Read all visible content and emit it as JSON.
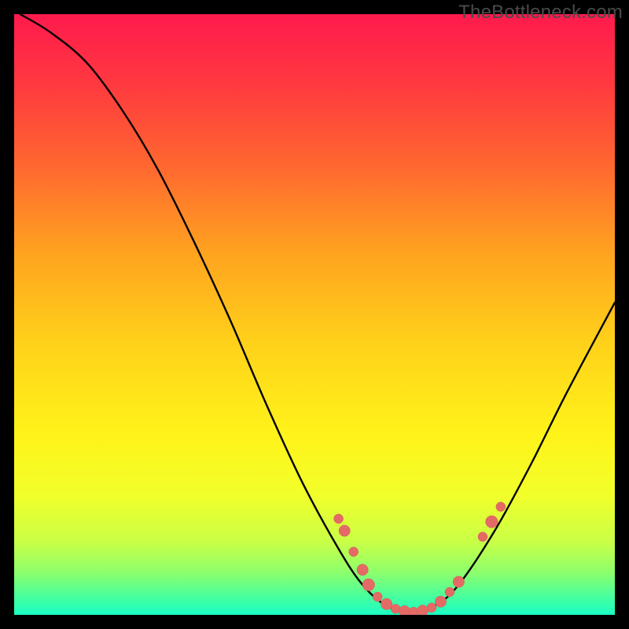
{
  "watermark": "TheBottleneck.com",
  "colors": {
    "frame": "#000000",
    "curve": "#000000",
    "dot_fill": "#e46a66",
    "dot_stroke": "#d45a56",
    "gradient_stops": [
      "#ff1a4d",
      "#ff3a3f",
      "#ff6a2f",
      "#ffa41f",
      "#ffd21a",
      "#fff31a",
      "#f2ff2a",
      "#c8ff47",
      "#8cff6d",
      "#47ff9e",
      "#1affc4"
    ]
  },
  "chart_data": {
    "type": "line",
    "title": "",
    "xlabel": "",
    "ylabel": "",
    "xlim": [
      0,
      100
    ],
    "ylim": [
      0,
      100
    ],
    "grid": false,
    "legend": false,
    "curve_description": "Asymmetric V-shaped bottleneck curve. Left branch descends steeply from top-left, reaches a flat minimum near zero around x≈60–70, then rises with a gentler slope toward the right edge. Background gradient encodes severity: red (high) at top to green (low) at bottom.",
    "curve_points": [
      {
        "x": 1.0,
        "y": 100.0
      },
      {
        "x": 6.0,
        "y": 97.0
      },
      {
        "x": 12.0,
        "y": 92.0
      },
      {
        "x": 18.0,
        "y": 84.0
      },
      {
        "x": 24.0,
        "y": 74.0
      },
      {
        "x": 30.0,
        "y": 62.0
      },
      {
        "x": 36.0,
        "y": 49.0
      },
      {
        "x": 42.0,
        "y": 35.0
      },
      {
        "x": 48.0,
        "y": 22.0
      },
      {
        "x": 54.0,
        "y": 11.0
      },
      {
        "x": 58.0,
        "y": 5.0
      },
      {
        "x": 62.0,
        "y": 1.5
      },
      {
        "x": 66.0,
        "y": 0.5
      },
      {
        "x": 70.0,
        "y": 1.5
      },
      {
        "x": 74.0,
        "y": 5.0
      },
      {
        "x": 80.0,
        "y": 14.0
      },
      {
        "x": 86.0,
        "y": 25.0
      },
      {
        "x": 92.0,
        "y": 37.0
      },
      {
        "x": 100.0,
        "y": 52.0
      }
    ],
    "dots_description": "Salmon-colored sample dots clustered on the lower part of both branches and along the valley floor.",
    "dots": [
      {
        "x": 54.0,
        "y": 16.0,
        "r": 1.0
      },
      {
        "x": 55.0,
        "y": 14.0,
        "r": 1.2
      },
      {
        "x": 56.5,
        "y": 10.5,
        "r": 1.0
      },
      {
        "x": 58.0,
        "y": 7.5,
        "r": 1.2
      },
      {
        "x": 59.0,
        "y": 5.0,
        "r": 1.3
      },
      {
        "x": 60.5,
        "y": 3.0,
        "r": 1.0
      },
      {
        "x": 62.0,
        "y": 1.8,
        "r": 1.2
      },
      {
        "x": 63.5,
        "y": 1.0,
        "r": 1.0
      },
      {
        "x": 65.0,
        "y": 0.6,
        "r": 1.2
      },
      {
        "x": 66.5,
        "y": 0.5,
        "r": 1.0
      },
      {
        "x": 68.0,
        "y": 0.7,
        "r": 1.2
      },
      {
        "x": 69.5,
        "y": 1.2,
        "r": 1.0
      },
      {
        "x": 71.0,
        "y": 2.2,
        "r": 1.2
      },
      {
        "x": 72.5,
        "y": 3.8,
        "r": 1.0
      },
      {
        "x": 74.0,
        "y": 5.5,
        "r": 1.2
      },
      {
        "x": 78.0,
        "y": 13.0,
        "r": 1.0
      },
      {
        "x": 79.5,
        "y": 15.5,
        "r": 1.3
      },
      {
        "x": 81.0,
        "y": 18.0,
        "r": 1.0
      }
    ]
  }
}
